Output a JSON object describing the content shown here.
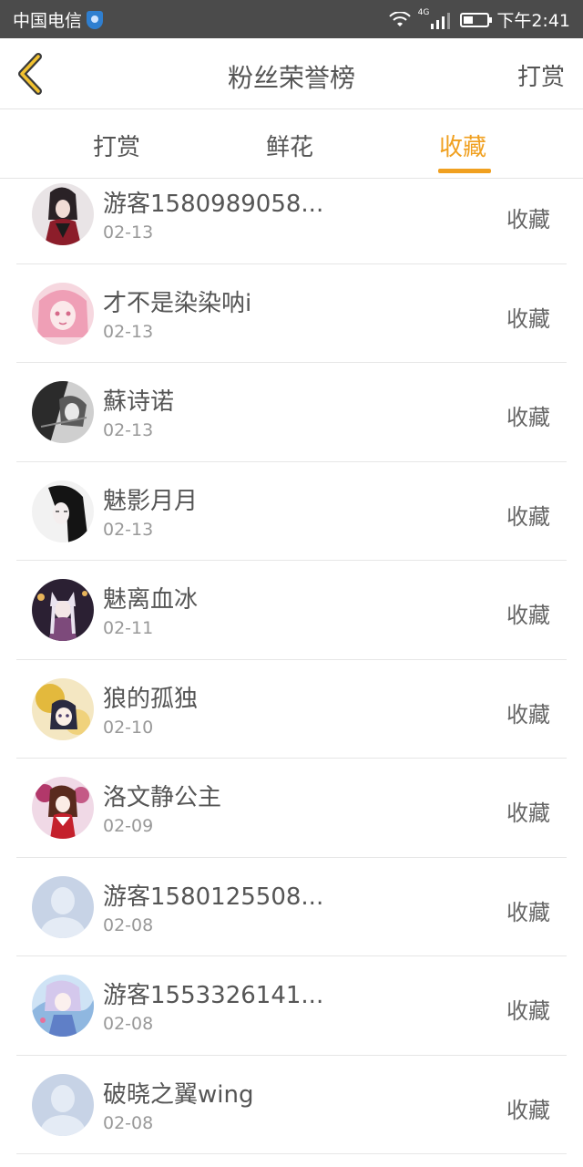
{
  "status_bar": {
    "carrier": "中国电信",
    "network": "4G",
    "time": "下午2:41"
  },
  "header": {
    "title": "粉丝荣誉榜",
    "right_action": "打赏"
  },
  "tabs": [
    {
      "label": "打赏",
      "active": false
    },
    {
      "label": "鲜花",
      "active": false
    },
    {
      "label": "收藏",
      "active": true
    }
  ],
  "accent_color": "#f0a020",
  "items": [
    {
      "name": "游客1580989058...",
      "date": "02-13",
      "action": "收藏",
      "avatar": "avatar-dark-robed-figure"
    },
    {
      "name": "才不是染染呐i",
      "date": "02-13",
      "action": "收藏",
      "avatar": "avatar-pink-anime-girl"
    },
    {
      "name": "蘇诗诺",
      "date": "02-13",
      "action": "收藏",
      "avatar": "avatar-monochrome-anime"
    },
    {
      "name": "魅影月月",
      "date": "02-13",
      "action": "收藏",
      "avatar": "avatar-black-hair-girl"
    },
    {
      "name": "魅离血冰",
      "date": "02-11",
      "action": "收藏",
      "avatar": "avatar-fox-girl-night"
    },
    {
      "name": "狼的孤独",
      "date": "02-10",
      "action": "收藏",
      "avatar": "avatar-anime-girl-gold"
    },
    {
      "name": "洛文静公主",
      "date": "02-09",
      "action": "收藏",
      "avatar": "avatar-shrine-maiden"
    },
    {
      "name": "游客1580125508...",
      "date": "02-08",
      "action": "收藏",
      "avatar": "avatar-default-silhouette"
    },
    {
      "name": "游客1553326141...",
      "date": "02-08",
      "action": "收藏",
      "avatar": "avatar-blue-anime-boy"
    },
    {
      "name": "破晓之翼wing",
      "date": "02-08",
      "action": "收藏",
      "avatar": "avatar-default-silhouette"
    }
  ]
}
